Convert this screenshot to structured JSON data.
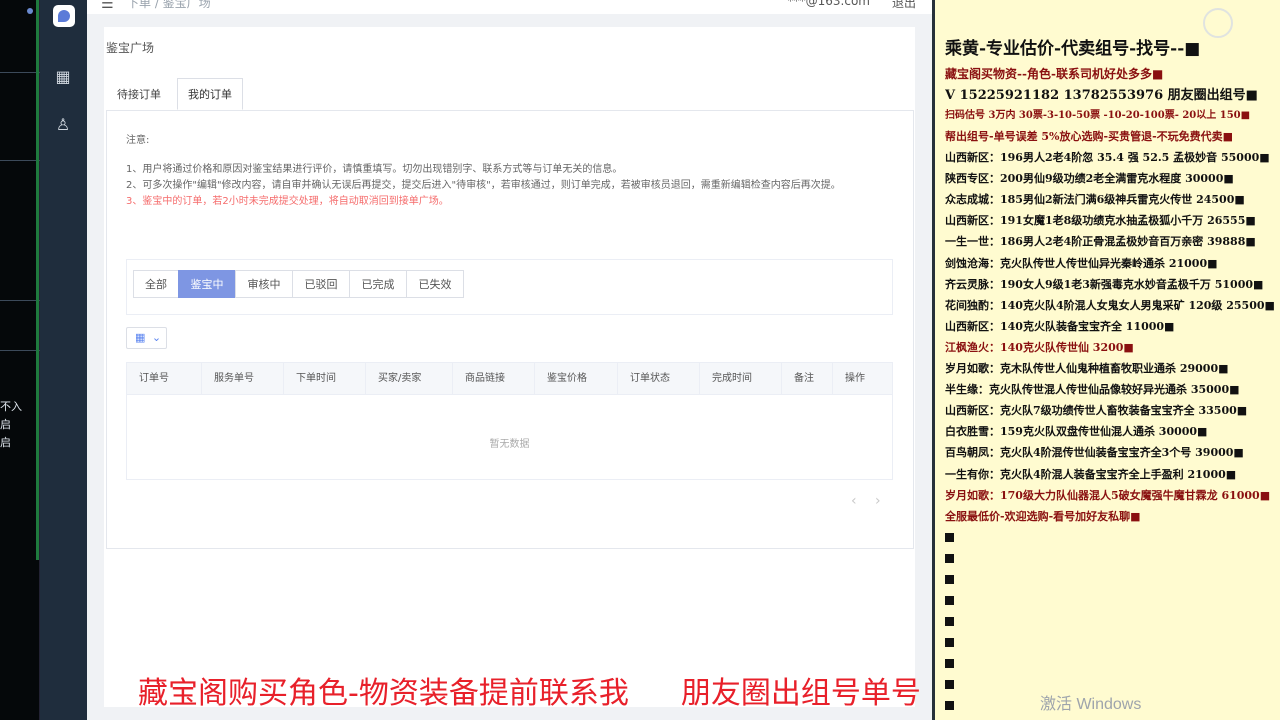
{
  "left_strip": {
    "lines": [
      "不入",
      "启",
      "启"
    ]
  },
  "topbar": {
    "crumb": "下单 / 鉴宝广场",
    "user": "***@163.com",
    "logout": "退出"
  },
  "page": {
    "title": "鉴宝广场"
  },
  "tabs": [
    {
      "label": "待接订单",
      "active": false
    },
    {
      "label": "我的订单",
      "active": true
    }
  ],
  "notes": {
    "head": "注意:",
    "items": [
      "1、用户将通过价格和原因对鉴宝结果进行评价，请慎重填写。切勿出现错别字、联系方式等与订单无关的信息。",
      "2、可多次操作\"编辑\"修改内容，请自审并确认无误后再提交，提交后进入\"待审核\"，若审核通过，则订单完成，若被审核员退回，需重新编辑检查内容后再次提。",
      "3、鉴宝中的订单，若2小时未完成提交处理，将自动取消回到接单广场。"
    ]
  },
  "filters": [
    {
      "label": "全部",
      "active": false
    },
    {
      "label": "鉴宝中",
      "active": true
    },
    {
      "label": "审核中",
      "active": false
    },
    {
      "label": "已驳回",
      "active": false
    },
    {
      "label": "已完成",
      "active": false
    },
    {
      "label": "已失效",
      "active": false
    }
  ],
  "table": {
    "columns": [
      "订单号",
      "服务单号",
      "下单时间",
      "买家/卖家",
      "商品链接",
      "鉴宝价格",
      "订单状态",
      "完成时间",
      "备注",
      "操作"
    ],
    "empty_text": "暂无数据"
  },
  "stream": {
    "lines": [
      {
        "text": "乘黄-专业估价-代卖组号-找号--■",
        "color": "#111111"
      },
      {
        "text": "藏宝阁买物资--角色-联系司机好处多多■",
        "color": "#8a1010"
      },
      {
        "text": "V 15225921182   13782553976 朋友圈出组号■",
        "color": "#111111"
      },
      {
        "text": "扫码估号 3万内 30票-3-10-50票 -10-20-100票- 20以上 150■",
        "color": "#8a1010"
      },
      {
        "text": "帮出组号-单号误差 5%放心选购-买贵管退-不玩免费代卖■",
        "color": "#8a1010"
      },
      {
        "text": "山西新区：196男人2老4阶忽 35.4 强 52.5 孟极妙音 55000■",
        "color": "#111111"
      },
      {
        "text": "陕西专区：200男仙9级功绩2老全满雷克水程度 30000■",
        "color": "#111111"
      },
      {
        "text": "众志成城：185男仙2新法门满6级神兵雷克火传世 24500■",
        "color": "#111111"
      },
      {
        "text": "山西新区：191女魔1老8级功绩克水抽孟极狐小千万 26555■",
        "color": "#111111"
      },
      {
        "text": "一生一世：186男人2老4阶正骨混孟极妙音百万亲密 39888■",
        "color": "#111111"
      },
      {
        "text": "剑蚀沧海：克火队传世人传世仙异光秦岭通杀 21000■",
        "color": "#111111"
      },
      {
        "text": "齐云灵脉：190女人9级1老3新强毒克水妙音孟极千万 51000■",
        "color": "#111111"
      },
      {
        "text": "花间独酌：140克火队4阶混人女鬼女人男鬼采矿 120级 25500■",
        "color": "#111111"
      },
      {
        "text": "山西新区：140克火队装备宝宝齐全 11000■",
        "color": "#111111"
      },
      {
        "text": "江枫渔火：140克火队传世仙 3200■",
        "color": "#8a1010"
      },
      {
        "text": "岁月如歌：克木队传世人仙鬼种植畜牧职业通杀 29000■",
        "color": "#111111"
      },
      {
        "text": "半生缘：克火队传世混人传世仙品像较好异光通杀 35000■",
        "color": "#111111"
      },
      {
        "text": "山西新区：克火队7级功绩传世人畜牧装备宝宝齐全 33500■",
        "color": "#111111"
      },
      {
        "text": "白衣胜雪：159克火队双盘传世仙混人通杀 30000■",
        "color": "#111111"
      },
      {
        "text": "百鸟朝凤：克火队4阶混传世仙装备宝宝齐全3个号 39000■",
        "color": "#111111"
      },
      {
        "text": "一生有你：克火队4阶混人装备宝宝齐全上手盈利 21000■",
        "color": "#111111"
      },
      {
        "text": "岁月如歌：170级大力队仙器混人5破女魔强牛魔甘霖龙 61000■",
        "color": "#8a1010"
      },
      {
        "text": "全服最低价-欢迎选购-看号加好友私聊■",
        "color": "#8a1010"
      }
    ]
  },
  "caption": {
    "left": "藏宝阁购买角色-物资装备提前联系我",
    "right": "朋友圈出组号单号"
  },
  "os_watermark": "激活 Windows"
}
